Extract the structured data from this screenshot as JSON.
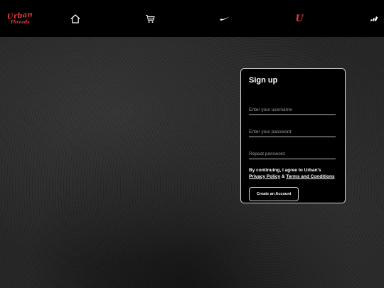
{
  "navbar": {
    "logo_line1": "Urban",
    "logo_line2": "Threads",
    "items": [
      {
        "name": "home",
        "icon": "home-icon"
      },
      {
        "name": "cart",
        "icon": "cart-icon"
      },
      {
        "name": "nike",
        "icon": "nike-swoosh-icon"
      },
      {
        "name": "urban-threads",
        "icon": "ut-logo-icon",
        "text": "U"
      },
      {
        "name": "adidas",
        "icon": "adidas-logo-icon"
      }
    ],
    "accent_color": "#e23a3a"
  },
  "signup": {
    "title": "Sign up",
    "username_placeholder": "Enter your username",
    "password_placeholder": "Enter your password",
    "repeat_placeholder": "Repeat password",
    "consent_prefix": "By continuing, I agree to Urban's",
    "privacy_link": "Privacy Policy",
    "and_text": " & ",
    "terms_link": "Terms and Conditions",
    "create_button": "Create an Account"
  }
}
